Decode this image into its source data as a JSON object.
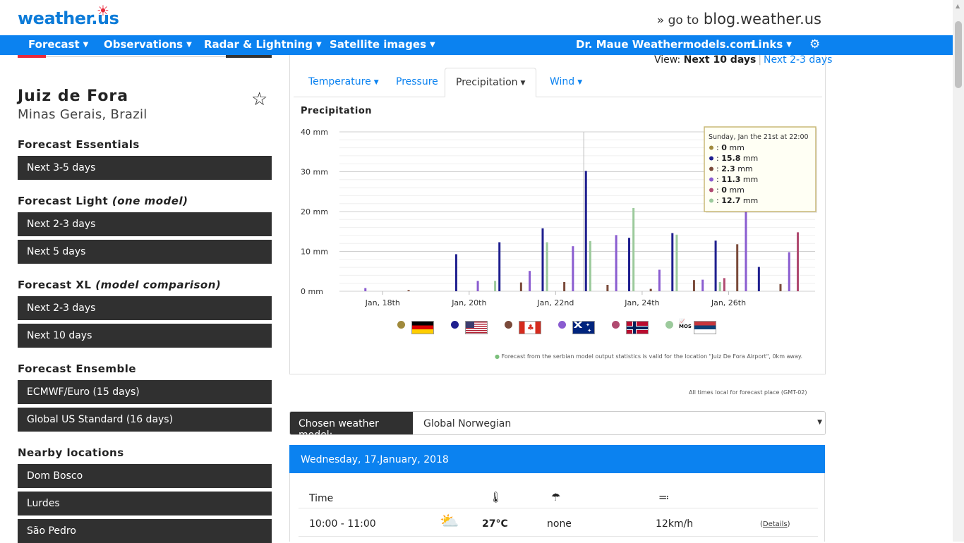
{
  "header": {
    "logo": "weather.us",
    "blog_prefix": "» go to",
    "blog_link": "blog.weather.us"
  },
  "nav": {
    "forecast": "Forecast",
    "observations": "Observations",
    "radar": "Radar & Lightning",
    "satellite": "Satellite images",
    "maue": "Dr. Maue Weathermodels.com",
    "links": "Links"
  },
  "location": {
    "city": "Juiz de Fora",
    "region": "Minas Gerais, Brazil"
  },
  "sidebar": {
    "essentials_title": "Forecast Essentials",
    "essentials_items": [
      "Next 3-5 days"
    ],
    "light_title": "Forecast Light",
    "light_note": "(one model)",
    "light_items": [
      "Next 2-3 days",
      "Next 5 days"
    ],
    "xl_title": "Forecast XL",
    "xl_note": "(model comparison)",
    "xl_items": [
      "Next 2-3 days",
      "Next 10 days"
    ],
    "ensemble_title": "Forecast Ensemble",
    "ensemble_items": [
      "ECMWF/Euro (15 days)",
      "Global US Standard (16 days)"
    ],
    "nearby_title": "Nearby locations",
    "nearby_items": [
      "Dom Bosco",
      "Lurdes",
      "São Pedro"
    ]
  },
  "view": {
    "label": "View:",
    "current": "Next 10 days",
    "other": "Next 2-3 days"
  },
  "tabs": [
    "Temperature",
    "Pressure",
    "Precipitation",
    "Wind"
  ],
  "chart_title": "Precipitation",
  "chart_data": {
    "type": "bar",
    "title": "Precipitation",
    "unit": "mm",
    "ylim": [
      0,
      40
    ],
    "yticks": [
      "0 mm",
      "10 mm",
      "20 mm",
      "30 mm",
      "40 mm"
    ],
    "x_tick_labels": [
      "Jan, 18th",
      "Jan, 20th",
      "Jan, 22nd",
      "Jan, 24th",
      "Jan, 26th"
    ],
    "x_tick_positions_days": [
      1,
      3,
      5,
      7,
      9
    ],
    "xlim_days": [
      0,
      11
    ],
    "series": [
      {
        "color": "#a08a3c",
        "days": [],
        "values": []
      },
      {
        "color": "#1f1f8f",
        "days": [
          2.7,
          3.7,
          4.7,
          5.7,
          6.7,
          7.7,
          8.7,
          9.7
        ],
        "values": [
          9.3,
          12.3,
          15.8,
          30.2,
          13.4,
          14.6,
          12.7,
          6.1
        ]
      },
      {
        "color": "#7a4a3a",
        "days": [
          1.6,
          4.2,
          5.2,
          6.2,
          7.2,
          8.2,
          9.2,
          10.2
        ],
        "values": [
          0.3,
          2.2,
          2.3,
          1.6,
          0.6,
          2.8,
          11.8,
          1.8
        ]
      },
      {
        "color": "#8a5cd0",
        "days": [
          0.6,
          3.2,
          4.4,
          5.4,
          6.4,
          7.4,
          8.4,
          9.4,
          10.4
        ],
        "values": [
          0.8,
          2.6,
          5.1,
          11.3,
          14.1,
          5.4,
          2.9,
          20.5,
          9.8
        ]
      },
      {
        "color": "#b04a70",
        "days": [
          8.9,
          10.6
        ],
        "values": [
          3.3,
          14.8
        ]
      },
      {
        "color": "#9cca9c",
        "days": [
          3.6,
          4.8,
          5.8,
          6.8,
          7.8,
          8.8
        ],
        "values": [
          2.6,
          12.3,
          12.6,
          20.9,
          14.2,
          2.3
        ]
      }
    ],
    "legend_flags": [
      "Germany",
      "USA",
      "Canada",
      "Australia",
      "Norway",
      "Serbia (MOS)"
    ]
  },
  "tooltip": {
    "title": "Sunday, Jan the 21st at 22:00",
    "rows": [
      {
        "color": "#a08a3c",
        "value": "0",
        "unit": "mm"
      },
      {
        "color": "#1f1f8f",
        "value": "15.8",
        "unit": "mm"
      },
      {
        "color": "#7a4a3a",
        "value": "2.3",
        "unit": "mm"
      },
      {
        "color": "#8a5cd0",
        "value": "11.3",
        "unit": "mm"
      },
      {
        "color": "#b04a70",
        "value": "0",
        "unit": "mm"
      },
      {
        "color": "#9cca9c",
        "value": "12.7",
        "unit": "mm"
      }
    ]
  },
  "mos_label": "MOS",
  "footnote": "Forecast from the serbian model output statistics is valid for the location \"Juiz De Fora Airport\", 0km away.",
  "times_note": "All times local for forecast place  (GMT-02)",
  "model_select": {
    "label": "Chosen weather model:",
    "value": "Global Norwegian"
  },
  "day": {
    "title": "Wednesday, 17.January, 2018",
    "col_time": "Time",
    "rows": [
      {
        "time": "10:00 - 11:00",
        "temp": "27°C",
        "precip": "none",
        "wind": "12km/h",
        "details": "Details"
      }
    ]
  }
}
